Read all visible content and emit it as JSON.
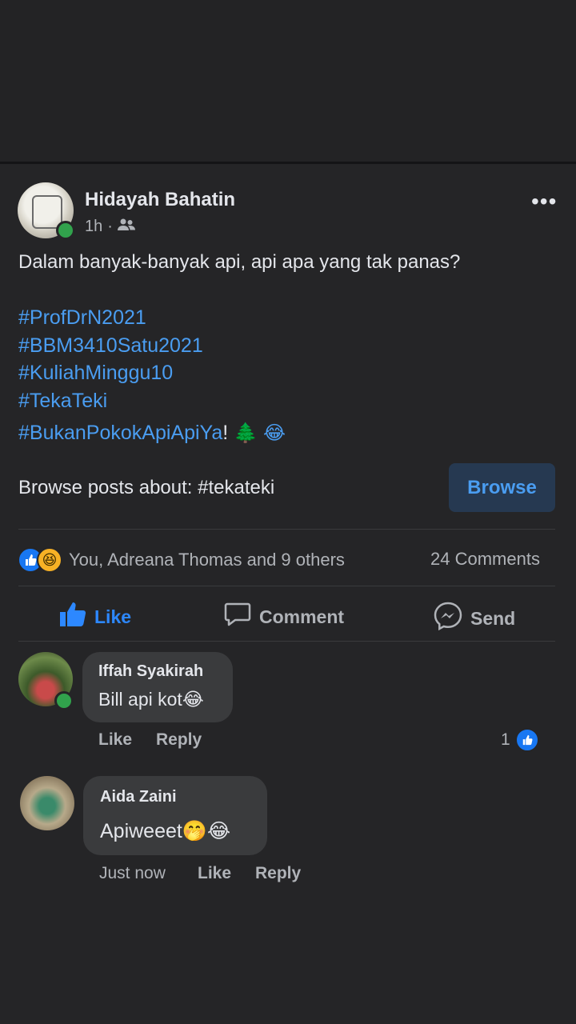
{
  "post": {
    "author": "Hidayah Bahatin",
    "time": "1h",
    "separator": "·",
    "text": "Dalam banyak-banyak api, api apa yang tak panas?",
    "hashtags": [
      "#ProfDrN2021",
      "#BBM3410Satu2021",
      "#KuliahMinggu10",
      "#TekaTeki"
    ],
    "last_hashtag": "#BukanPokokApiApiYa",
    "last_suffix": "!",
    "emojis": [
      "🌲",
      "😂"
    ],
    "browse_text": "Browse posts about: #tekateki",
    "browse_button": "Browse"
  },
  "engagement": {
    "reaction_icons": [
      "like-reaction-icon",
      "haha-reaction-icon"
    ],
    "reactions_text": "You, Adreana Thomas and 9 others",
    "comments_text": "24 Comments"
  },
  "actions": {
    "like": "Like",
    "comment": "Comment",
    "send": "Send"
  },
  "comments": [
    {
      "name": "Iffah Syakirah",
      "text": "Bill api kot😂",
      "like": "Like",
      "reply": "Reply",
      "reaction_count": "1"
    },
    {
      "name": "Aida Zaini",
      "text": "Apiweeet🤭😂",
      "time": "Just now",
      "like": "Like",
      "reply": "Reply"
    }
  ],
  "colors": {
    "background": "#232325",
    "accent": "#2d88ff",
    "hashtag": "#4a9df1",
    "online": "#31a24c"
  }
}
